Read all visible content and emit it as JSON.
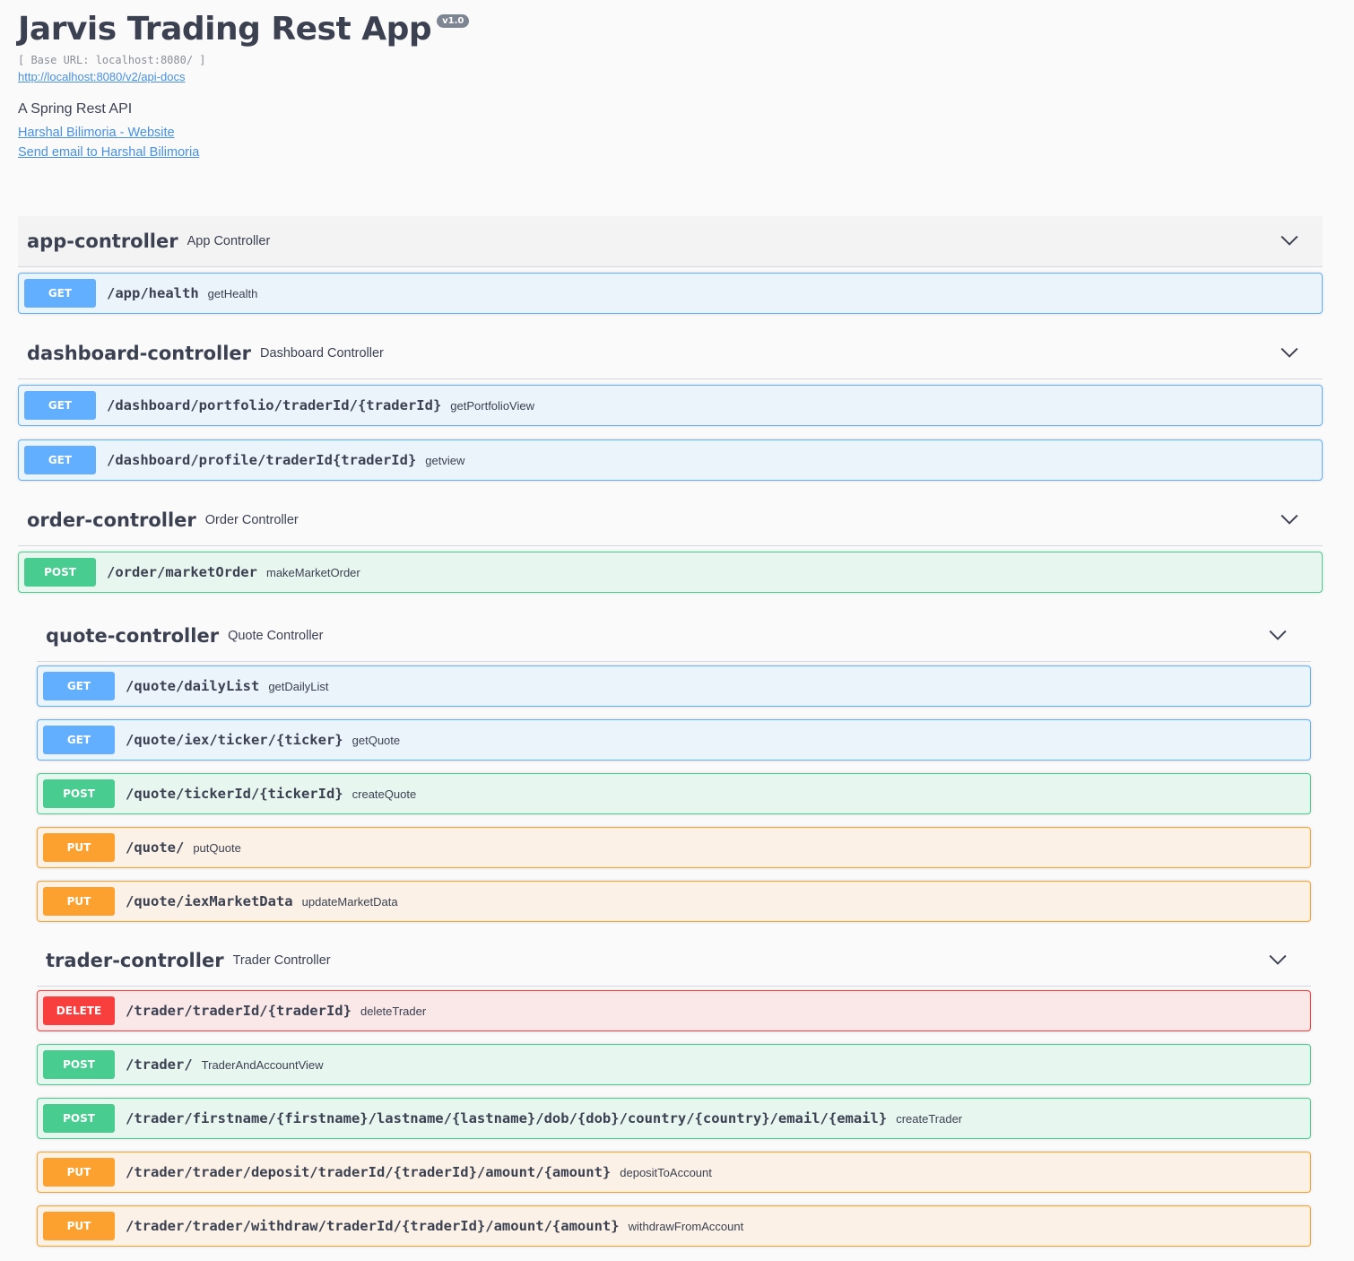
{
  "info": {
    "title": "Jarvis Trading Rest App",
    "version": "v1.0",
    "base_url": "[ Base URL: localhost:8080/ ]",
    "api_docs_link": "http://localhost:8080/v2/api-docs",
    "description": "A Spring Rest API",
    "contact_website": "Harshal Bilimoria - Website",
    "contact_email": "Send email to Harshal Bilimoria"
  },
  "colors": {
    "get": "#61affe",
    "post": "#49cc90",
    "put": "#fca130",
    "delete": "#f93e3e",
    "link": "#4990e2",
    "text": "#3b4151"
  },
  "icons": {
    "expand": "chevron-down-icon"
  },
  "tags": [
    {
      "name": "app-controller",
      "description": "App Controller",
      "operations": [
        {
          "method": "GET",
          "path": "/app/health",
          "summary": "getHealth"
        }
      ]
    },
    {
      "name": "dashboard-controller",
      "description": "Dashboard Controller",
      "operations": [
        {
          "method": "GET",
          "path": "/dashboard/portfolio/traderId/{traderId}",
          "summary": "getPortfolioView"
        },
        {
          "method": "GET",
          "path": "/dashboard/profile/traderId{traderId}",
          "summary": "getview"
        }
      ]
    },
    {
      "name": "order-controller",
      "description": "Order Controller",
      "operations": [
        {
          "method": "POST",
          "path": "/order/marketOrder",
          "summary": "makeMarketOrder"
        }
      ]
    },
    {
      "name": "quote-controller",
      "description": "Quote Controller",
      "operations": [
        {
          "method": "GET",
          "path": "/quote/dailyList",
          "summary": "getDailyList"
        },
        {
          "method": "GET",
          "path": "/quote/iex/ticker/{ticker}",
          "summary": "getQuote"
        },
        {
          "method": "POST",
          "path": "/quote/tickerId/{tickerId}",
          "summary": "createQuote"
        },
        {
          "method": "PUT",
          "path": "/quote/",
          "summary": "putQuote"
        },
        {
          "method": "PUT",
          "path": "/quote/iexMarketData",
          "summary": "updateMarketData"
        }
      ]
    },
    {
      "name": "trader-controller",
      "description": "Trader Controller",
      "operations": [
        {
          "method": "DELETE",
          "path": "/trader/traderId/{traderId}",
          "summary": "deleteTrader"
        },
        {
          "method": "POST",
          "path": "/trader/",
          "summary": "TraderAndAccountView"
        },
        {
          "method": "POST",
          "path": "/trader/firstname/{firstname}/lastname/{lastname}/dob/{dob}/country/{country}/email/{email}",
          "summary": "createTrader"
        },
        {
          "method": "PUT",
          "path": "/trader/trader/deposit/traderId/{traderId}/amount/{amount}",
          "summary": "depositToAccount"
        },
        {
          "method": "PUT",
          "path": "/trader/trader/withdraw/traderId/{traderId}/amount/{amount}",
          "summary": "withdrawFromAccount"
        }
      ]
    }
  ]
}
